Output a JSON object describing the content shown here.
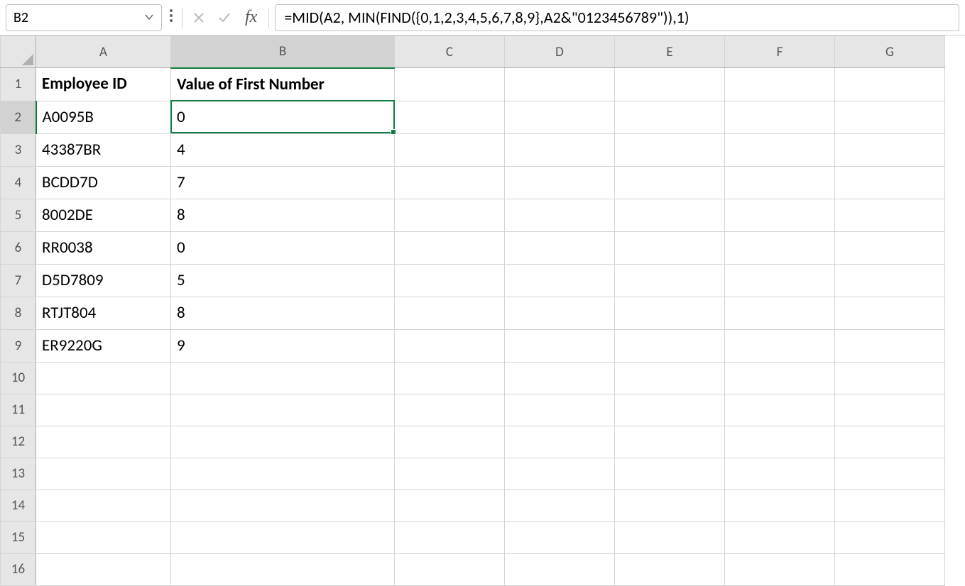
{
  "formula_bar": {
    "cell_reference": "B2",
    "fx_label": "fx",
    "formula": "=MID(A2, MIN(FIND({0,1,2,3,4,5,6,7,8,9},A2&\"0123456789\")),1)"
  },
  "columns": [
    "A",
    "B",
    "C",
    "D",
    "E",
    "F",
    "G"
  ],
  "visible_rows": 16,
  "selected_cell": "B2",
  "selected_col_index": 1,
  "selected_row_index": 1,
  "headers": {
    "A": "Employee ID",
    "B": "Value of First Number"
  },
  "data_rows": [
    {
      "A": "A0095B",
      "B": "0"
    },
    {
      "A": "43387BR",
      "B": "4"
    },
    {
      "A": "BCDD7D",
      "B": "7"
    },
    {
      "A": "8002DE",
      "B": "8"
    },
    {
      "A": "RR0038",
      "B": "0"
    },
    {
      "A": "D5D7809",
      "B": "5"
    },
    {
      "A": "RTJT804",
      "B": "8"
    },
    {
      "A": "ER9220G",
      "B": "9"
    }
  ]
}
